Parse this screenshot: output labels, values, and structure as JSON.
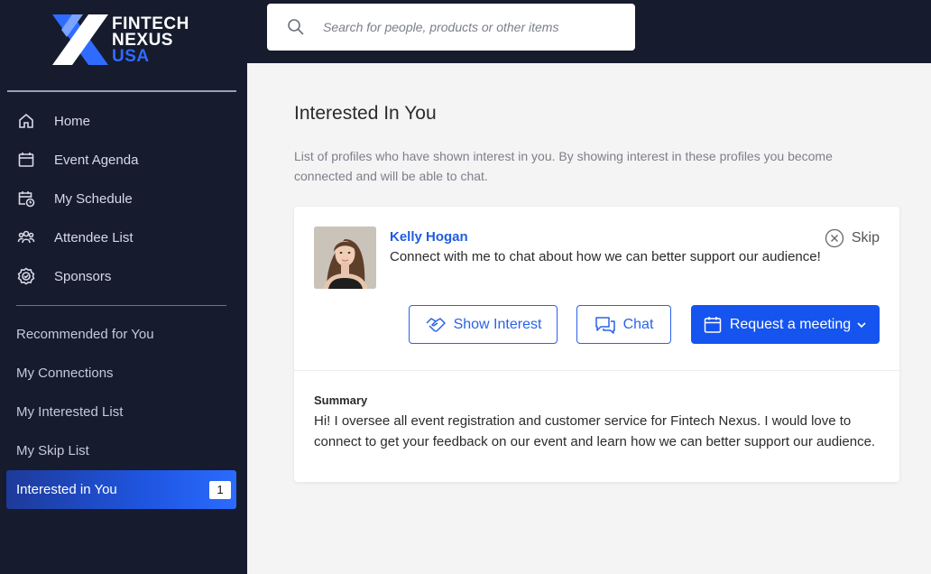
{
  "brand": {
    "line1": "FINTECH",
    "line2": "NEXUS",
    "line3": "USA",
    "accent_color": "#2f6bff"
  },
  "search": {
    "placeholder": "Search for people, products or other items",
    "value": ""
  },
  "sidebar": {
    "nav": [
      {
        "label": "Home",
        "icon": "home-icon"
      },
      {
        "label": "Event Agenda",
        "icon": "calendar-icon"
      },
      {
        "label": "My Schedule",
        "icon": "calendar-clock-icon"
      },
      {
        "label": "Attendee List",
        "icon": "group-icon"
      },
      {
        "label": "Sponsors",
        "icon": "sponsor-badge-icon"
      }
    ],
    "lists": [
      {
        "label": "Recommended for You"
      },
      {
        "label": "My Connections"
      },
      {
        "label": "My Interested List"
      },
      {
        "label": "My Skip List"
      }
    ],
    "active": {
      "label": "Interested in You",
      "count": "1"
    }
  },
  "main": {
    "title": "Interested In You",
    "description": "List of profiles who have shown interest in you. By showing interest in these profiles you become connected and will be able to chat."
  },
  "profile": {
    "name": "Kelly Hogan",
    "tagline": "Connect with me to chat about how we can better support our audience!",
    "skip_label": "Skip",
    "actions": {
      "show_interest": "Show Interest",
      "chat": "Chat",
      "request_meeting": "Request a meeting"
    },
    "summary_label": "Summary",
    "summary": "Hi! I oversee all event registration and customer service for Fintech Nexus. I would love to connect to get your feedback on our event and learn how we can better support our audience."
  },
  "colors": {
    "sidebar_bg": "#161b2e",
    "primary": "#1654f0",
    "link": "#1f5de0"
  }
}
